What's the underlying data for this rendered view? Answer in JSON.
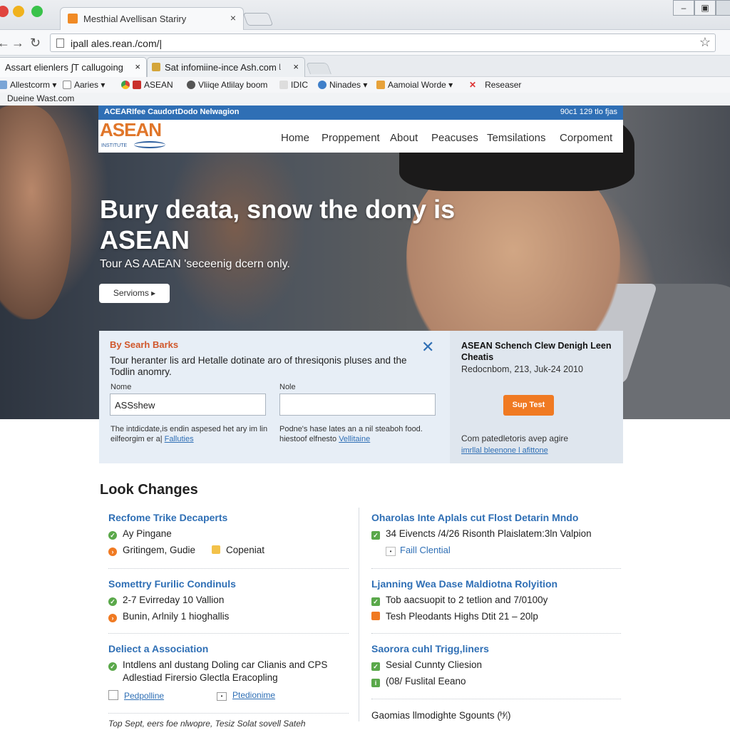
{
  "browser": {
    "tab_title": "Mesthial Avellisan Stariry",
    "url": "ipall ales.rean./com/|",
    "tabs2": [
      {
        "label": "Assart elienlers ∫T callugoing"
      },
      {
        "label": "Sat infomiine-ince Ash.com ᶩ"
      }
    ],
    "bookmarks": [
      "Allestcorm ▾",
      "Aaries ▾",
      "ASEAN",
      "Vliiqe Atlilay boom",
      "IDIC",
      "Ninades ▾",
      "Aamoial Worde ▾",
      "Reseaser"
    ],
    "status_text": "Dueine Wast.com",
    "close_glyph": "×"
  },
  "site": {
    "topbar_left": "ACEARIfee CaudortDodo Nelwagion",
    "topbar_right": "90c1 129 tlo fjas",
    "logo_text": "ASEAN",
    "logo_sub": "INSTITUTE",
    "nav": [
      "Home",
      "Proppement",
      "About",
      "Peacuses",
      "Temsilations",
      "Corpoment"
    ]
  },
  "hero": {
    "title": "Bury deata, snow the dony is ASEAN",
    "subtitle": "Tour AS AAEAN 'seceenig dcern only.",
    "button": "Servioms ▸"
  },
  "search_panel": {
    "heading": "By Searh Barks",
    "close": "✕",
    "description": "Tour heranter lis ard Hetalle dotinate aro of thresiqonis pluses and the Todlin anomry.",
    "left_label": "Nome",
    "left_value": "ASSshew",
    "right_label": "Nole",
    "right_value": "",
    "left_note": "The intdicdate,is endin aspesed het ary im lin eilfeorgim er a|",
    "left_note_link": "Falluties",
    "right_note": "Podne's hase lates an a nil steaboh food. hiestoof elfnesto",
    "right_note_link": "Vellitaine"
  },
  "promo": {
    "title": "ASEAN Schench Clew Denigh Leen Cheatis",
    "date": "Redocnbom, 213, Juk-24 2010",
    "button": "Sup Test",
    "foot": "Com patedletoris avep agire",
    "foot_link": "imrllal bleenone l afittone"
  },
  "section": {
    "title": "Look Changes",
    "left": [
      {
        "title": "Recfome Trike Decaperts",
        "items": [
          "Ay Pingane",
          "Gritingem, Gudie"
        ],
        "extra": "Copeniat"
      },
      {
        "title": "Somettry Furilic Condinuls",
        "items": [
          "2-7 Evirreday 10 Vallion",
          "Bunin, Arlnily 1 hioghallis"
        ]
      },
      {
        "title": "Deliect a Association",
        "items": [
          "Intdlens anl dustang Doling car Clianis and CPS",
          "Adlestiad Firersio Glectla Eracopling"
        ],
        "links": [
          "Pedpolline",
          "Ptedionime"
        ]
      }
    ],
    "right": [
      {
        "title": "Oharolas Inte Aplals cut Flost Detarin Mndo",
        "items": [
          "34 Eivencts /4/26 Risonth Plaislatem:3ln Valpion"
        ],
        "link": "Faill Clential"
      },
      {
        "title": "Ljanning Wea Dase Maldiotna Rolyition",
        "items": [
          "Tob aacsuopit to 2 tetlion and 7/0100y",
          "Tesh Pleodants Highs Dtit 21 – 20lp"
        ]
      },
      {
        "title": "Saorora cuhl Trigg,liners",
        "items": [
          "Sesial Cunnty Cliesion",
          "(08/ Fuslital Eeano"
        ]
      }
    ],
    "right_bottom": "Gaomias llmodighte Sgounts (ᴴ⁄ᵢ)",
    "footnote": "Top Sept, eers foe nlwopre, Tesiz Solat sovell Sateh"
  },
  "colors": {
    "accent_blue": "#2f6fb5",
    "accent_orange": "#f07a22",
    "green": "#5aa84a"
  }
}
